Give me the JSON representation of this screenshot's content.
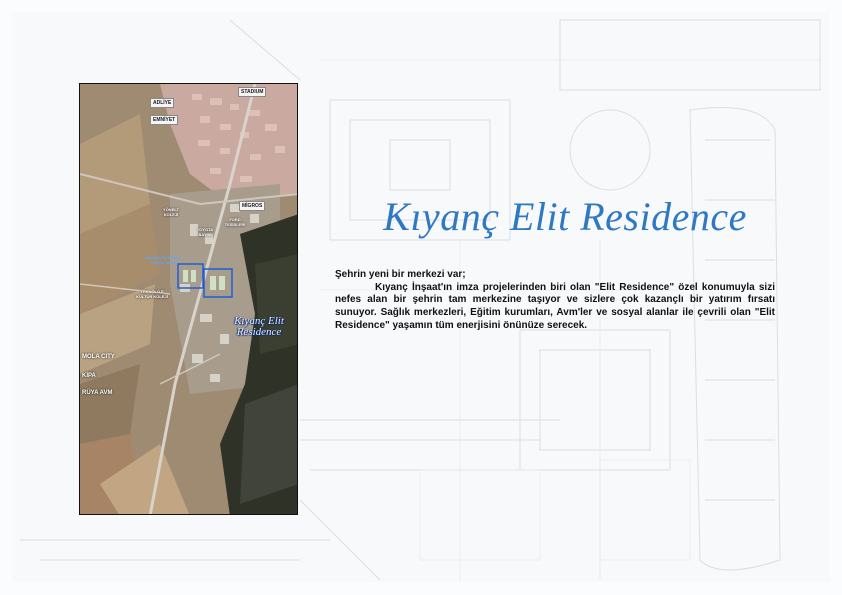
{
  "title": "Kıyanç Elit Residence",
  "body": {
    "lead": "Şehrin yeni bir merkezi var;",
    "paragraph": "Kıyanç İnşaat'ın imza projelerinden biri olan \"Elit Residence\" özel konumuyla sizi nefes alan bir şehrin tam merkezine taşıyor ve sizlere çok kazançlı bir yatırım fırsatı sunuyor. Sağlık merkezleri, Eğitim kurumları, Avm'ler ve sosyal alanlar ile çevrili olan \"Elit Residence\" yaşamın tüm enerjisini önünüze serecek."
  },
  "map": {
    "place_label": "Kıyanç Elit Residence",
    "labels": {
      "adliye": "ADLİYE",
      "emniyet": "EMNİYET",
      "stadium": "STADIUM",
      "migros": "MİGROS",
      "yonelt": "YÖNELT KOLEJİ",
      "ford": "FORD TESİSLERİ",
      "togo": "TOYOTA BAYİSİ",
      "teknoloji": "TEKNOLOJİ KÜLTÜR KOLEJİ",
      "blue_note": "Mahalle Park Alanı Sosyal Tesis",
      "mola": "MOLA CITY",
      "kipa": "KİPA",
      "ruya": "RÜYA AVM"
    }
  },
  "colors": {
    "title": "#2f78c4",
    "text": "#111111",
    "marker": "#1f5fd1"
  }
}
